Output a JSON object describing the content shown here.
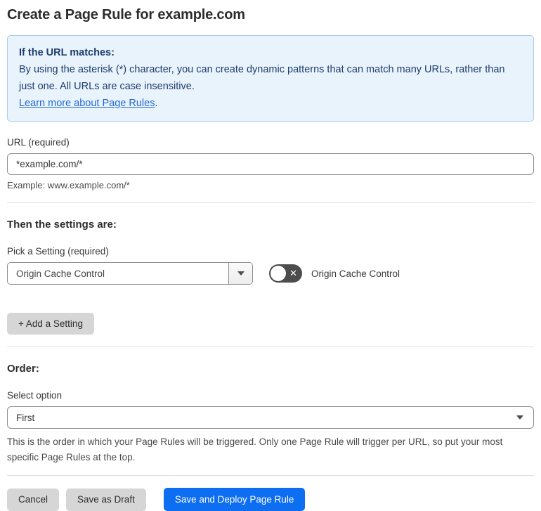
{
  "page": {
    "title": "Create a Page Rule for example.com"
  },
  "info_box": {
    "heading": "If the URL matches:",
    "body": "By using the asterisk (*) character, you can create dynamic patterns that can match many URLs, rather than just one. All URLs are case insensitive.",
    "link": "Learn more about Page Rules",
    "link_suffix": "."
  },
  "url_field": {
    "label": "URL (required)",
    "value": "*example.com/*",
    "helper": "Example: www.example.com/*"
  },
  "settings": {
    "heading": "Then the settings are:",
    "pick_label": "Pick a Setting (required)",
    "dropdown_value": "Origin Cache Control",
    "toggle": {
      "state": "off",
      "off_glyph": "✕",
      "label": "Origin Cache Control"
    },
    "add_button": "+ Add a Setting"
  },
  "order": {
    "heading": "Order:",
    "select_label": "Select option",
    "select_value": "First",
    "helper": "This is the order in which your Page Rules will be triggered. Only one Page Rule will trigger per URL, so put your most specific Page Rules at the top."
  },
  "footer": {
    "cancel": "Cancel",
    "save_draft": "Save as Draft",
    "save_deploy": "Save and Deploy Page Rule"
  },
  "colors": {
    "accent_blue": "#0d6ef2",
    "info_background": "#e9f3fc",
    "info_border": "#a9cdef",
    "info_text": "#1e3c6e",
    "link_blue": "#2268d3",
    "toggle_off": "#4d4d4d",
    "button_gray": "#d6d6d6"
  }
}
